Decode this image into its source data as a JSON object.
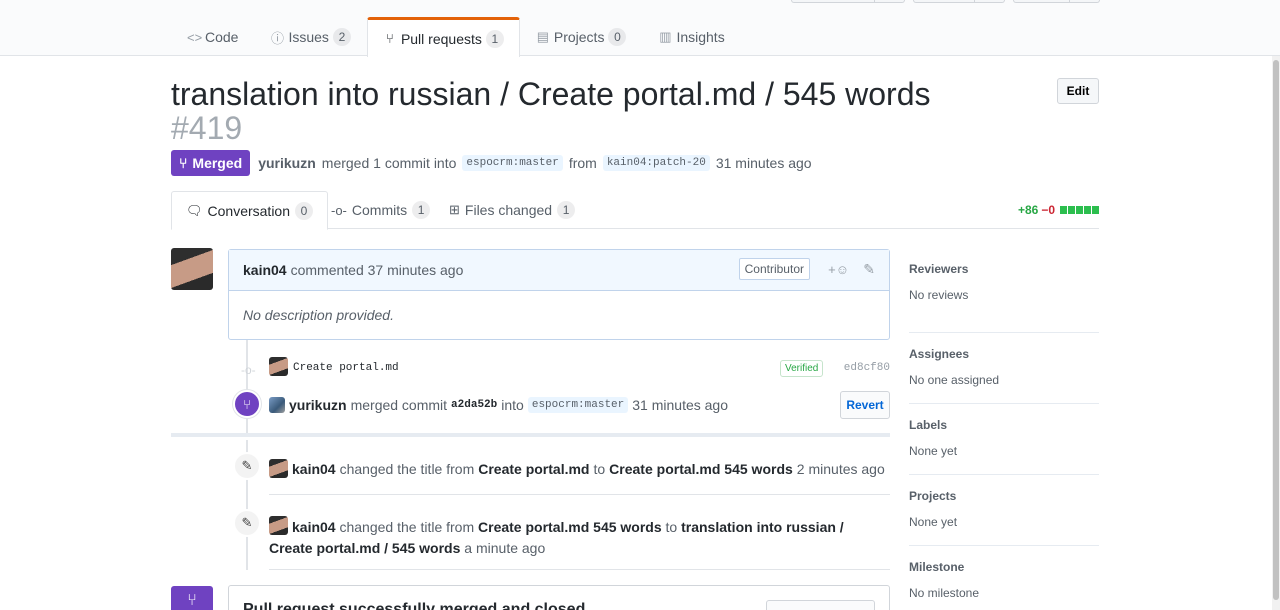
{
  "repo_nav": {
    "tabs": [
      {
        "label": "Code",
        "count": null,
        "icon": "code-icon"
      },
      {
        "label": "Issues",
        "count": "2",
        "icon": "issue-icon"
      },
      {
        "label": "Pull requests",
        "count": "1",
        "icon": "pull-request-icon"
      },
      {
        "label": "Projects",
        "count": "0",
        "icon": "project-icon"
      },
      {
        "label": "Insights",
        "count": null,
        "icon": "graph-icon"
      }
    ],
    "active_tab": "Pull requests"
  },
  "pr": {
    "title": "translation into russian / Create portal.md / 545 words",
    "number": "#419",
    "edit_label": "Edit",
    "state": "Merged",
    "merger": "yurikuzn",
    "merge_text": "merged 1 commit into",
    "base_branch": "espocrm:master",
    "from_text": "from",
    "head_branch": "kain04:patch-20",
    "merged_time": "31 minutes ago"
  },
  "pr_tabs": {
    "conversation": {
      "label": "Conversation",
      "count": "0"
    },
    "commits": {
      "label": "Commits",
      "count": "1"
    },
    "files": {
      "label": "Files changed",
      "count": "1"
    }
  },
  "diffstat": {
    "additions": "+86",
    "deletions": "−0",
    "blocks": 5,
    "add_color": "#28a745",
    "del_color": "#cb2431"
  },
  "comment": {
    "author": "kain04",
    "action": "commented 37 minutes ago",
    "role": "Contributor",
    "body": "No description provided."
  },
  "commit": {
    "message": "Create portal.md",
    "verified": "Verified",
    "sha": "ed8cf80"
  },
  "merge_event": {
    "user": "yurikuzn",
    "text1": "merged commit",
    "sha": "a2da52b",
    "text2": "into",
    "branch": "espocrm:master",
    "time": "31 minutes ago",
    "revert_label": "Revert"
  },
  "rename_event_1": {
    "user": "kain04",
    "text": "changed the title from",
    "from": "Create portal.md",
    "to_word": "to",
    "to": "Create portal.md 545 words",
    "time": "2 minutes ago"
  },
  "rename_event_2": {
    "user": "kain04",
    "text": "changed the title from",
    "from": "Create portal.md 545 words",
    "to_word": "to",
    "to": "translation into russian / Create portal.md / 545 words",
    "time": "a minute ago"
  },
  "merged_box": {
    "title": "Pull request successfully merged and closed"
  },
  "sidebar": {
    "reviewers": {
      "label": "Reviewers",
      "value": "No reviews"
    },
    "assignees": {
      "label": "Assignees",
      "value": "No one assigned"
    },
    "labels": {
      "label": "Labels",
      "value": "None yet"
    },
    "projects": {
      "label": "Projects",
      "value": "None yet"
    },
    "milestone": {
      "label": "Milestone",
      "value": "No milestone"
    }
  },
  "colors": {
    "accent": "#e36209",
    "merged": "#6f42c1",
    "link": "#0366d6"
  }
}
